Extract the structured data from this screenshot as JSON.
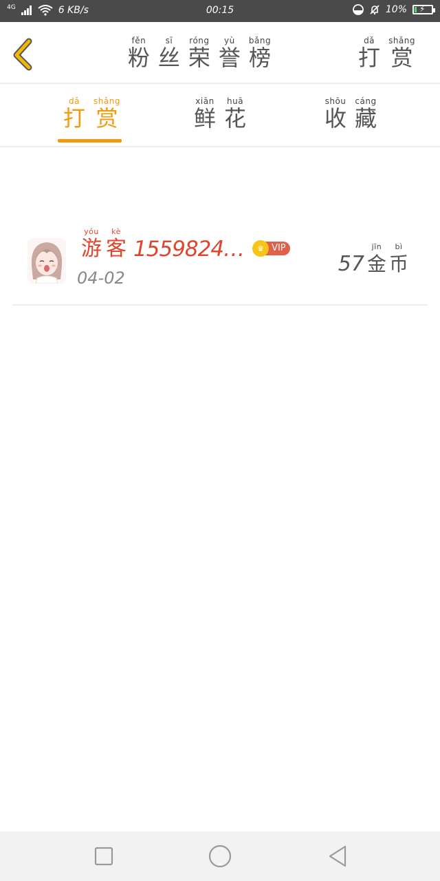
{
  "status_bar": {
    "network": "4G",
    "speed": "6 KB/s",
    "time": "00:15",
    "battery_percent": "10%",
    "icons": [
      "signal-icon",
      "wifi-icon",
      "alarm-icon",
      "mute-bell-icon",
      "battery-charging-icon"
    ]
  },
  "header": {
    "title": [
      {
        "py": "fěn",
        "hz": "粉"
      },
      {
        "py": "sī",
        "hz": "丝"
      },
      {
        "py": "róng",
        "hz": "荣"
      },
      {
        "py": "yù",
        "hz": "誉"
      },
      {
        "py": "bǎng",
        "hz": "榜"
      }
    ],
    "reward": [
      {
        "py": "dǎ",
        "hz": "打"
      },
      {
        "py": "shǎng",
        "hz": "赏"
      }
    ]
  },
  "tabs": [
    {
      "chars": [
        {
          "py": "dǎ",
          "hz": "打"
        },
        {
          "py": "shǎng",
          "hz": "赏"
        }
      ],
      "active": true
    },
    {
      "chars": [
        {
          "py": "xiān",
          "hz": "鲜"
        },
        {
          "py": "huā",
          "hz": "花"
        }
      ],
      "active": false
    },
    {
      "chars": [
        {
          "py": "shōu",
          "hz": "收"
        },
        {
          "py": "cáng",
          "hz": "藏"
        }
      ],
      "active": false
    }
  ],
  "list": [
    {
      "name_chars": [
        {
          "py": "yóu",
          "hz": "游"
        },
        {
          "py": "kè",
          "hz": "客"
        }
      ],
      "name_number": "1559824…",
      "vip_label": "VIP",
      "date": "04-02",
      "amount": "57",
      "unit": [
        {
          "py": "jīn",
          "hz": "金"
        },
        {
          "py": "bì",
          "hz": "币"
        }
      ]
    }
  ],
  "colors": {
    "accent": "#f09a0c",
    "name_red": "#e0442c",
    "back_arrow": "#f2b705",
    "statusbar_bg": "#4a4a4a"
  }
}
